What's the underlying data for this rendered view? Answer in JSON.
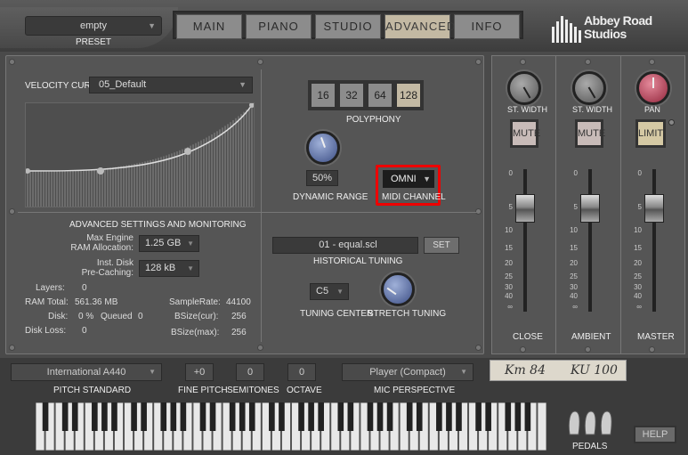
{
  "preset": {
    "value": "empty",
    "label": "PRESET"
  },
  "tabs": [
    {
      "label": "MAIN"
    },
    {
      "label": "PIANO"
    },
    {
      "label": "STUDIO"
    },
    {
      "label": "ADVANCED"
    },
    {
      "label": "INFO"
    }
  ],
  "logo": {
    "line1": "Abbey Road",
    "line2": "Studios"
  },
  "velocity": {
    "label": "VELOCITY CURVE",
    "value": "05_Default"
  },
  "polyphony": {
    "label": "POLYPHONY",
    "options": [
      "16",
      "32",
      "64",
      "128"
    ],
    "selected": "128"
  },
  "dynamic_range": {
    "label": "DYNAMIC RANGE",
    "value": "50%"
  },
  "midi": {
    "label": "MIDI CHANNEL",
    "value": "OMNI"
  },
  "advanced": {
    "title": "ADVANCED SETTINGS AND MONITORING",
    "max_engine_label1": "Max Engine",
    "max_engine_label2": "RAM Allocation:",
    "max_engine_value": "1.25 GB",
    "inst_disk_label1": "Inst. Disk",
    "inst_disk_label2": "Pre-Caching:",
    "inst_disk_value": "128 kB",
    "layers_label": "Layers:",
    "layers_value": "0",
    "ram_label": "RAM Total:",
    "ram_value": "561.36 MB",
    "disk_label": "Disk:",
    "disk_value": "0 %",
    "queued_label": "Queued",
    "queued_value": "0",
    "disk_loss_label": "Disk Loss:",
    "disk_loss_value": "0",
    "samplerate_label": "SampleRate:",
    "samplerate_value": "44100",
    "bsize_cur_label": "BSize(cur):",
    "bsize_cur_value": "256",
    "bsize_max_label": "BSize(max):",
    "bsize_max_value": "256"
  },
  "tuning": {
    "file": "01 - equal.scl",
    "set_label": "SET",
    "label": "HISTORICAL TUNING",
    "center_value": "C5",
    "center_label": "TUNING CENTER",
    "stretch_label": "STRETCH TUNING"
  },
  "mixer": {
    "strips": [
      {
        "knob_label": "ST. WIDTH",
        "button": "MUTE",
        "name": "CLOSE"
      },
      {
        "knob_label": "ST. WIDTH",
        "button": "MUTE",
        "name": "AMBIENT"
      },
      {
        "knob_label": "PAN",
        "button": "LIMIT",
        "name": "MASTER"
      }
    ],
    "scale": [
      "0",
      "5",
      "10",
      "15",
      "20",
      "25",
      "30",
      "40",
      "∞"
    ]
  },
  "bottom": {
    "pitch_std_value": "International  A440",
    "pitch_std_label": "PITCH STANDARD",
    "fine_pitch_value": "+0",
    "fine_pitch_label": "FINE PITCH",
    "semitones_value": "0",
    "semitones_label": "SEMITONES",
    "octave_value": "0",
    "octave_label": "OCTAVE",
    "mic_value": "Player (Compact)",
    "mic_label": "MIC PERSPECTIVE",
    "mic1": "Km 84",
    "mic2": "KU 100",
    "pedals_label": "PEDALS",
    "help_label": "HELP"
  }
}
